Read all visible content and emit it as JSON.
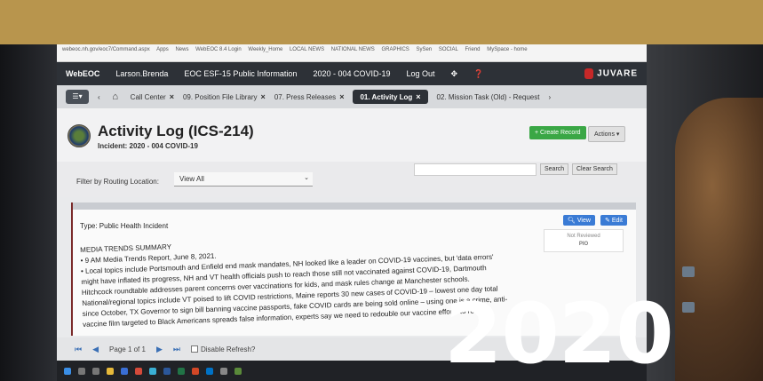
{
  "browser": {
    "address": "webeoc.nh.gov/eoc7/Command.aspx",
    "bookmarks": [
      "Apps",
      "News",
      "WebEOC 8.4 Login",
      "Weekly_Home",
      "LOCAL NEWS",
      "NATIONAL NEWS",
      "GRAPHICS",
      "SySen",
      "SOCIAL",
      "Friend",
      "MySpace - home"
    ]
  },
  "app_nav": {
    "brand": "WebEOC",
    "user": "Larson.Brenda",
    "position": "EOC ESF-15 Public Information",
    "incident": "2020 - 004 COVID-19",
    "logout": "Log Out",
    "vendor": "JUVARE"
  },
  "tabs": [
    {
      "label": "Call Center"
    },
    {
      "label": "09. Position File Library"
    },
    {
      "label": "07. Press Releases"
    },
    {
      "label": "01. Activity Log"
    },
    {
      "label": "02. Mission Task (Old) - Request"
    }
  ],
  "page": {
    "title": "Activity Log (ICS-214)",
    "incident": "Incident: 2020 - 004 COVID-19",
    "create_label": "+ Create Record",
    "actions_label": "Actions"
  },
  "filter": {
    "label": "Filter by Routing Location:",
    "selected": "View All",
    "search_label": "Search",
    "clear_label": "Clear Search"
  },
  "record": {
    "view_label": "View",
    "edit_label": "Edit",
    "review_status": "Not Reviewed",
    "review_owner": "PIO",
    "type": "Type: Public Health Incident",
    "lines": [
      "MEDIA TRENDS SUMMARY",
      "• 9 AM Media Trends Report, June 8, 2021.",
      "• Local topics include Portsmouth and Enfield end mask mandates, NH looked like a leader on COVID-19 vaccines, but 'data errors'",
      "might have inflated its progress, NH and VT health officials push to reach those still not vaccinated against COVID-19, Dartmouth",
      "Hitchcock roundtable addresses parent concerns over vaccinations for kids, and mask rules change at Manchester schools.",
      "National/regional topics include VT poised to lift COVID restrictions, Maine reports 30 new cases of COVID-19 – lowest one day total",
      "since October, TX Governor to sign bill banning vaccine passports, fake COVID cards are being sold online – using one is a crime, anti-",
      "vaccine film targeted to Black Americans spreads false information, experts say we need to redouble our vaccine efforts to reach"
    ]
  },
  "pager": {
    "text": "Page 1 of 1",
    "refresh_label": "Disable Refresh?"
  },
  "overlay": {
    "year": "2020"
  },
  "colors": {
    "gold_band": "#b8954d",
    "nav_dark": "#2d3137",
    "create_green": "#3aa745",
    "view_blue": "#3a7bd5"
  }
}
